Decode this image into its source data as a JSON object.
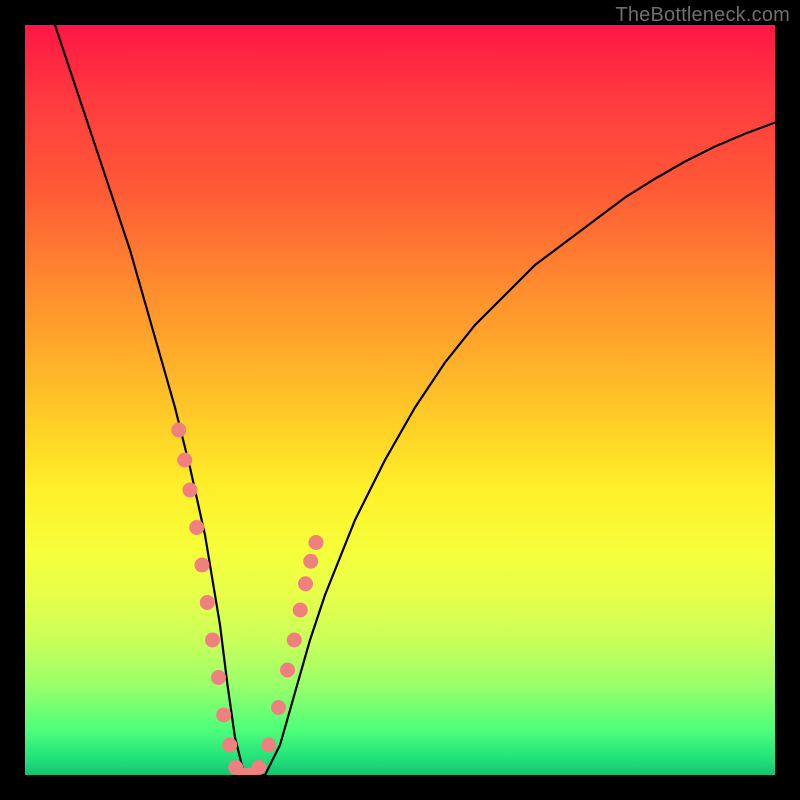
{
  "watermark": "TheBottleneck.com",
  "colors": {
    "frame": "#000000",
    "curve": "#000000",
    "dots": "#f08080",
    "gradient_top": "#ff1744",
    "gradient_bottom": "#18c070"
  },
  "chart_data": {
    "type": "line",
    "title": "",
    "xlabel": "",
    "ylabel": "",
    "xlim": [
      0,
      100
    ],
    "ylim": [
      0,
      100
    ],
    "series": [
      {
        "name": "bottleneck-curve",
        "x": [
          4,
          6,
          8,
          10,
          12,
          14,
          16,
          18,
          20,
          22,
          24,
          25,
          26,
          27,
          28,
          29,
          30,
          32,
          34,
          36,
          38,
          40,
          44,
          48,
          52,
          56,
          60,
          64,
          68,
          72,
          76,
          80,
          84,
          88,
          92,
          96,
          100
        ],
        "y": [
          100,
          94,
          88,
          82,
          76,
          70,
          63,
          56,
          49,
          41,
          32,
          26,
          20,
          12,
          5,
          1,
          0,
          0,
          4,
          11,
          18,
          24,
          34,
          42,
          49,
          55,
          60,
          64,
          68,
          71,
          74,
          77,
          79.5,
          81.8,
          83.8,
          85.5,
          87
        ]
      }
    ],
    "highlight_points": {
      "name": "marker-dots",
      "x": [
        20.5,
        21.3,
        22.0,
        22.9,
        23.6,
        24.3,
        25.0,
        25.8,
        26.5,
        27.3,
        28.1,
        29.0,
        30.0,
        31.2,
        32.5,
        33.8,
        35.0,
        35.9,
        36.7,
        37.4,
        38.1,
        38.8
      ],
      "y": [
        46,
        42,
        38,
        33,
        28,
        23,
        18,
        13,
        8,
        4,
        1,
        0,
        0,
        1,
        4,
        9,
        14,
        18,
        22,
        25.5,
        28.5,
        31
      ]
    }
  }
}
